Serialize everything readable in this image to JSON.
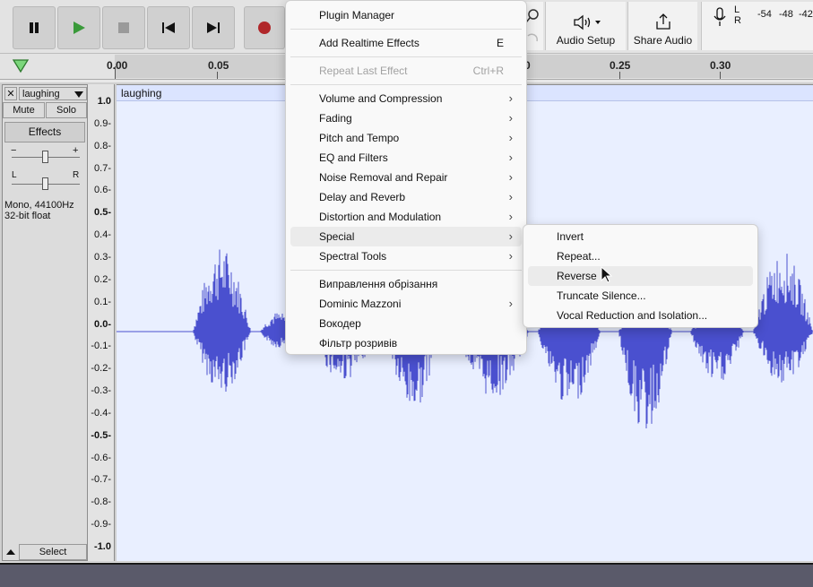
{
  "toolbar": {
    "audio_setup_label": "Audio Setup",
    "share_audio_label": "Share Audio",
    "meter_left": "L",
    "meter_right": "R",
    "meter_ticks": [
      "-54",
      "-48",
      "-42"
    ],
    "record_color": "#b0272a",
    "play_color": "#3a9a3a"
  },
  "ruler": {
    "ticks": [
      "0.00",
      "0.05",
      "0",
      "0.25",
      "0.30"
    ]
  },
  "track": {
    "name": "laughing",
    "close_glyph": "✕",
    "mute_label": "Mute",
    "solo_label": "Solo",
    "effects_label": "Effects",
    "gain_minus": "−",
    "gain_plus": "+",
    "pan_left": "L",
    "pan_right": "R",
    "info_line1": "Mono, 44100Hz",
    "info_line2": "32-bit float",
    "select_label": "Select",
    "clip_name": "laughing",
    "waveform_color": "#4a50cf"
  },
  "vertical_ruler": [
    "1.0",
    "0.9-",
    "0.8-",
    "0.7-",
    "0.6-",
    "0.5-",
    "0.4-",
    "0.3-",
    "0.2-",
    "0.1-",
    "0.0-",
    "-0.1-",
    "-0.2-",
    "-0.3-",
    "-0.4-",
    "-0.5-",
    "-0.6-",
    "-0.7-",
    "-0.8-",
    "-0.9-",
    "-1.0"
  ],
  "effect_menu": {
    "items": [
      {
        "label": "Plugin Manager"
      },
      {
        "label": "Add Realtime Effects",
        "shortcut": "E"
      },
      {
        "label": "Repeat Last Effect",
        "shortcut": "Ctrl+R",
        "disabled": true
      },
      {
        "label": "Volume and Compression",
        "submenu": true
      },
      {
        "label": "Fading",
        "submenu": true
      },
      {
        "label": "Pitch and Tempo",
        "submenu": true
      },
      {
        "label": "EQ and Filters",
        "submenu": true
      },
      {
        "label": "Noise Removal and Repair",
        "submenu": true
      },
      {
        "label": "Delay and Reverb",
        "submenu": true
      },
      {
        "label": "Distortion and Modulation",
        "submenu": true
      },
      {
        "label": "Special",
        "submenu": true,
        "highlighted": true
      },
      {
        "label": "Spectral Tools",
        "submenu": true
      },
      {
        "label": "Виправлення обрізання"
      },
      {
        "label": "Dominic Mazzoni",
        "submenu": true
      },
      {
        "label": "Вокодер"
      },
      {
        "label": "Фільтр розривів"
      }
    ]
  },
  "special_submenu": {
    "items": [
      {
        "label": "Invert"
      },
      {
        "label": "Repeat..."
      },
      {
        "label": "Reverse",
        "highlighted": true
      },
      {
        "label": "Truncate Silence..."
      },
      {
        "label": "Vocal Reduction and Isolation..."
      }
    ]
  },
  "submenu_arrow": "›"
}
